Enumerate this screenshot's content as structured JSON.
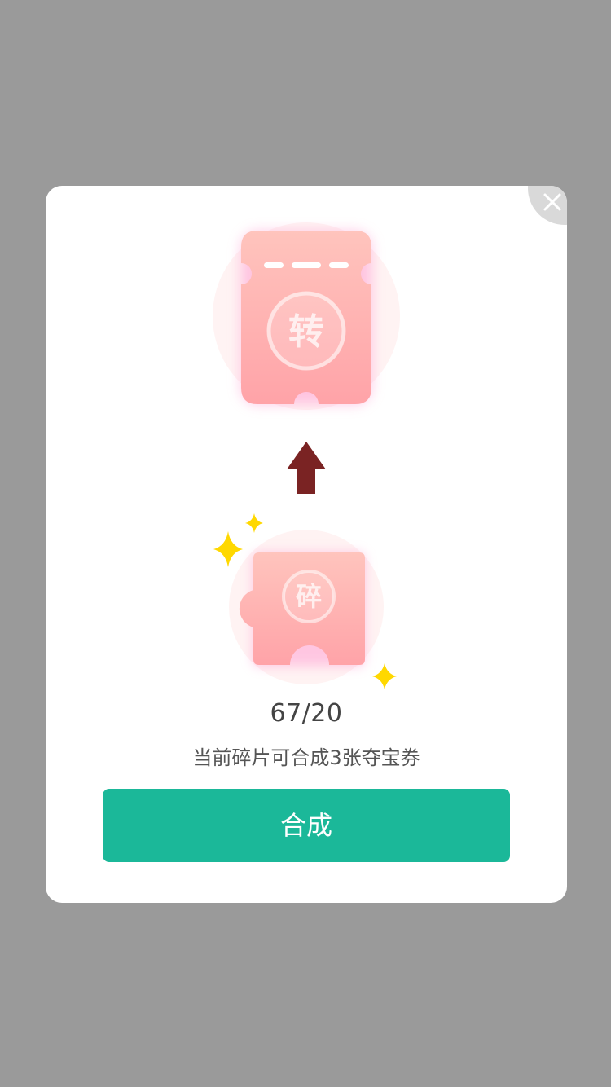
{
  "dialog": {
    "close_icon": "close-icon",
    "ticket": {
      "label": "转",
      "icon": "ticket-icon"
    },
    "arrow_icon": "arrow-up-icon",
    "piece": {
      "label": "碎",
      "icon": "puzzle-piece-icon"
    },
    "sparkle_icon": "sparkle-icon",
    "fragment_count": "67/20",
    "description": "当前碎片可合成3张夺宝券",
    "merge_button_label": "合成"
  },
  "colors": {
    "overlay": "#9a9a9a",
    "accent_green": "#1bb899",
    "ticket_pink": "#ffaaaa",
    "arrow_red": "#7a2323",
    "sparkle_yellow": "#ffd800"
  }
}
